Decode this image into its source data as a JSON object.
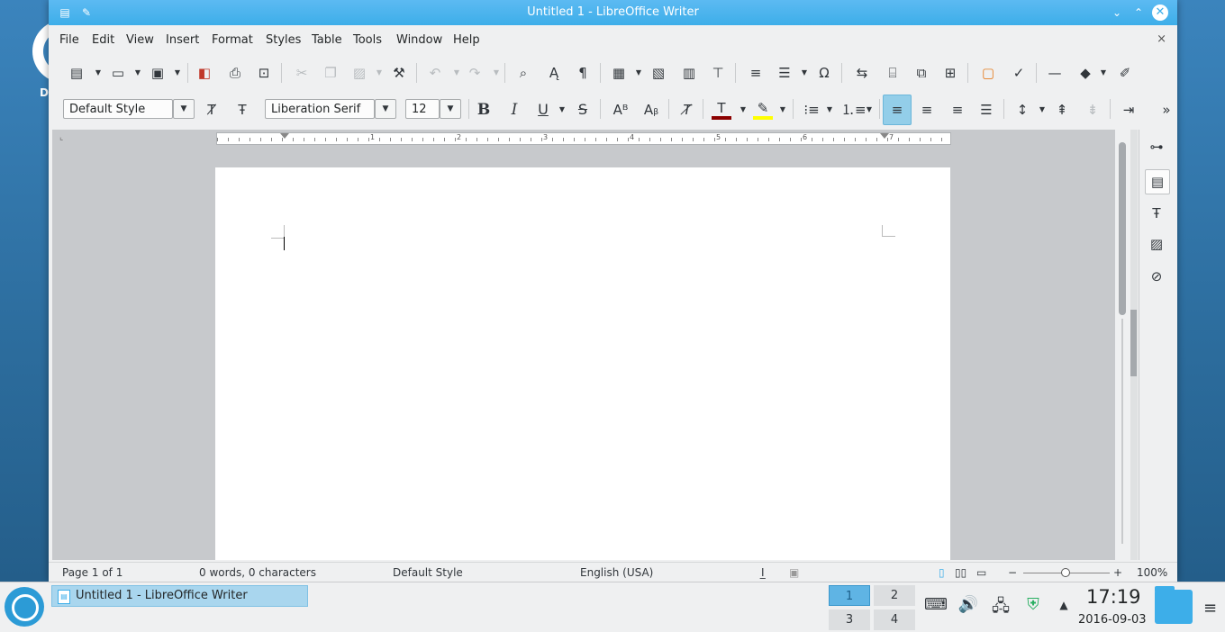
{
  "desktop": {
    "label": "D"
  },
  "window": {
    "title": "Untitled 1 - LibreOffice Writer",
    "close_glyph": "✕",
    "minimize_glyph": "⌄",
    "maximize_glyph": "⌃"
  },
  "menu": {
    "file": "File",
    "edit": "Edit",
    "view": "View",
    "insert": "Insert",
    "format": "Format",
    "styles": "Styles",
    "table": "Table",
    "tools": "Tools",
    "window": "Window",
    "help": "Help",
    "doc_close": "×"
  },
  "formatting": {
    "paragraph_style": "Default Style",
    "font_name": "Liberation Serif",
    "font_size": "12",
    "more_glyph": "»"
  },
  "ruler": {
    "numbers": [
      "1",
      "2",
      "3",
      "4",
      "5",
      "6",
      "7"
    ]
  },
  "statusbar": {
    "page": "Page 1 of 1",
    "words": "0 words, 0 characters",
    "style": "Default Style",
    "language": "English (USA)",
    "zoom": "100%",
    "zoom_minus": "−",
    "zoom_plus": "+"
  },
  "taskbar": {
    "task_label": "Untitled 1 - LibreOffice Writer",
    "pager": [
      "1",
      "2",
      "3",
      "4"
    ],
    "current_desktop": "1",
    "time": "17:19",
    "date": "2016-09-03"
  },
  "colors": {
    "titlebar": "#3daee9",
    "font_color": "#8b0000",
    "highlight": "#ffff00"
  }
}
